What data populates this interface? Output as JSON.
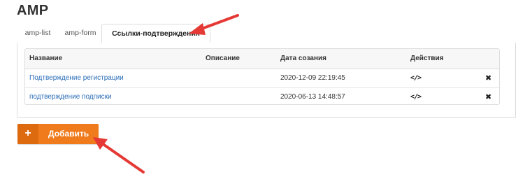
{
  "page": {
    "title": "AMP"
  },
  "tabs": [
    {
      "label": "amp-list",
      "active": false
    },
    {
      "label": "amp-form",
      "active": false
    },
    {
      "label": "Ссылки-подтверждения",
      "active": true
    }
  ],
  "table": {
    "headers": {
      "name": "Название",
      "description": "Описание",
      "date": "Дата сoзания",
      "actions": "Действия"
    },
    "rows": [
      {
        "name": "Подтверждение регистрации",
        "description": "",
        "date": "2020-12-09 22:19:45",
        "action_icon": "code-icon",
        "delete_icon": "close-icon"
      },
      {
        "name": "подтверждение подписки",
        "description": "",
        "date": "2020-06-13 14:48:57",
        "action_icon": "code-icon",
        "delete_icon": "close-icon"
      }
    ]
  },
  "add_button": {
    "icon": "+",
    "label": "Добавить",
    "color": "#f07b1d"
  },
  "code_icon_glyph": "</>",
  "delete_icon_glyph": "✖",
  "annotation_color": "#e53935"
}
